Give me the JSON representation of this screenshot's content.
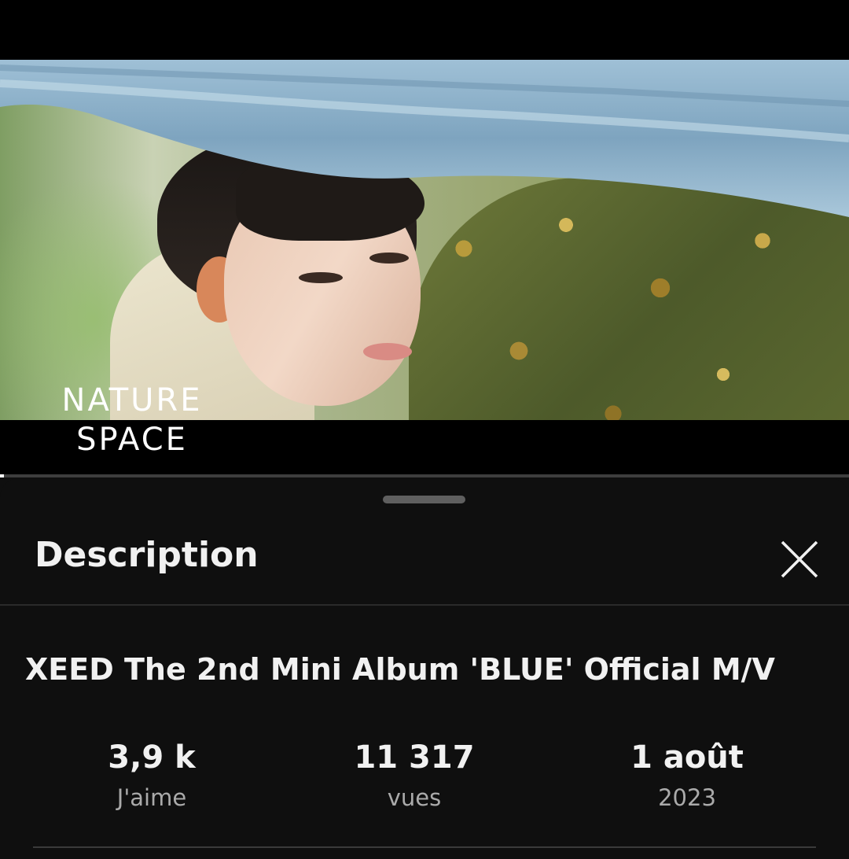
{
  "video": {
    "watermark_line1": "NATURE",
    "watermark_line2": "SPACE",
    "progress": 0.005
  },
  "sheet": {
    "heading": "Description",
    "close_icon": "close-icon",
    "video_title": "XEED The 2nd Mini Album 'BLUE' Official M/V",
    "stats": {
      "likes": {
        "value": "3,9 k",
        "label": "J'aime"
      },
      "views": {
        "value": "11 317",
        "label": "vues"
      },
      "date": {
        "value": "1 août",
        "label": "2023"
      }
    }
  },
  "colors": {
    "background": "#0f0f0f",
    "text_primary": "#f1f1f1",
    "text_secondary": "#aaaaaa",
    "divider": "#2a2a2a"
  }
}
